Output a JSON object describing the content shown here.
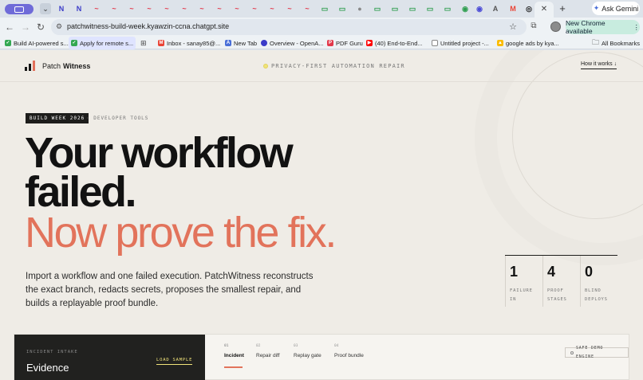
{
  "browser": {
    "tab_icons": [
      "N",
      "N",
      "~",
      "~",
      "~",
      "~",
      "~",
      "~",
      "~",
      "~",
      "~",
      "~",
      "~",
      "~",
      "~",
      "▭",
      "▭",
      "●",
      "▭",
      "▭",
      "▭",
      "▭",
      "▭",
      "◉",
      "A",
      "M",
      "◎"
    ],
    "new_tab_symbol": "+",
    "ask_gemini": "Ask Gemini",
    "url": "patchwitness-build-week.kyawzin-ccna.chatgpt.site",
    "update_label": "New Chrome available",
    "bookmarks": [
      {
        "label": "Build AI-powered s...",
        "color": "#34a853"
      },
      {
        "label": "Apply for remote s...",
        "color": "#34a853"
      },
      {
        "label": "Inbox - sanay85@...",
        "color": "#ea4335"
      },
      {
        "label": "New Tab",
        "color": "#4a6fd8"
      },
      {
        "label": "Overview - OpenA...",
        "color": "#3b3bc8"
      },
      {
        "label": "PDF Guru",
        "color": "#e3384a"
      },
      {
        "label": "(40) End-to-End...",
        "color": "#ff0000"
      },
      {
        "label": "Untitled project -...",
        "color": "#888888"
      },
      {
        "label": "google ads by kya...",
        "color": "#fbbc04"
      }
    ],
    "all_bookmarks": "All Bookmarks"
  },
  "site": {
    "brand_prefix": "Patch",
    "brand_name": "Witness",
    "tagline": "PRIVACY-FIRST AUTOMATION REPAIR",
    "how_it_works": "How it works  ↓"
  },
  "hero": {
    "badge": "BUILD WEEK 2026",
    "badge_sub": "·  DEVELOPER TOOLS",
    "line1": "Your workflow",
    "line2": "failed.",
    "line3": "Now prove the fix.",
    "description": "Import a workflow and one failed execution. PatchWitness reconstructs the exact branch, redacts secrets, proposes the smallest repair, and builds a replayable proof bundle."
  },
  "stats": [
    {
      "value": "1",
      "label": "FAILURE IN"
    },
    {
      "value": "4",
      "label": "PROOF STAGES"
    },
    {
      "value": "0",
      "label": "BLIND DEPLOYS"
    }
  ],
  "panel": {
    "intake_label": "INCIDENT INTAKE",
    "intake_title": "Evidence",
    "load_sample": "LOAD SAMPLE",
    "tabs": [
      {
        "num": "01",
        "label": "Incident"
      },
      {
        "num": "02",
        "label": "Repair diff"
      },
      {
        "num": "03",
        "label": "Replay gate"
      },
      {
        "num": "04",
        "label": "Proof bundle"
      }
    ],
    "engine": "SAFE DEMO ENGINE"
  }
}
